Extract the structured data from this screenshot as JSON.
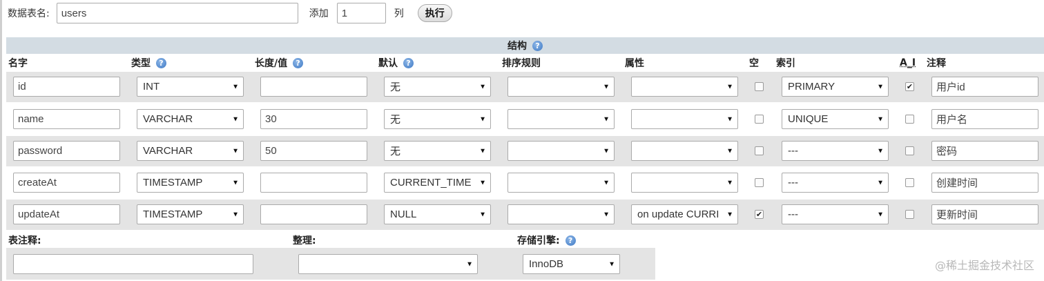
{
  "toolbar": {
    "table_name_label": "数据表名:",
    "table_name_value": "users",
    "add_label": "添加",
    "add_count": "1",
    "columns_unit": "列",
    "execute_label": "执行"
  },
  "structure": {
    "title": "结构",
    "help_icon": "help-icon",
    "headers": {
      "name": "名字",
      "type": "类型",
      "length": "长度/值",
      "default": "默认",
      "collation": "排序规则",
      "attributes": "属性",
      "null": "空",
      "index": "索引",
      "ai": "A_I",
      "comment": "注释"
    },
    "rows": [
      {
        "name": "id",
        "type": "INT",
        "length": "",
        "default": "无",
        "collation": "",
        "attributes": "",
        "null": false,
        "index": "PRIMARY",
        "ai": true,
        "comment": "用户id"
      },
      {
        "name": "name",
        "type": "VARCHAR",
        "length": "30",
        "default": "无",
        "collation": "",
        "attributes": "",
        "null": false,
        "index": "UNIQUE",
        "ai": false,
        "comment": "用户名"
      },
      {
        "name": "password",
        "type": "VARCHAR",
        "length": "50",
        "default": "无",
        "collation": "",
        "attributes": "",
        "null": false,
        "index": "---",
        "ai": false,
        "comment": "密码"
      },
      {
        "name": "createAt",
        "type": "TIMESTAMP",
        "length": "",
        "default": "CURRENT_TIME",
        "collation": "",
        "attributes": "",
        "null": false,
        "index": "---",
        "ai": false,
        "comment": "创建时间"
      },
      {
        "name": "updateAt",
        "type": "TIMESTAMP",
        "length": "",
        "default": "NULL",
        "collation": "",
        "attributes": "on update CURRI",
        "null": true,
        "index": "---",
        "ai": false,
        "comment": "更新时间"
      }
    ]
  },
  "table_options": {
    "comment_label": "表注释:",
    "comment_value": "",
    "collation_label": "整理:",
    "collation_value": "",
    "engine_label": "存储引擎:",
    "engine_value": "InnoDB"
  },
  "watermark": "@稀土掘金技术社区",
  "glyphs": {
    "arrow": "▼",
    "check": "✔",
    "help": "?"
  }
}
